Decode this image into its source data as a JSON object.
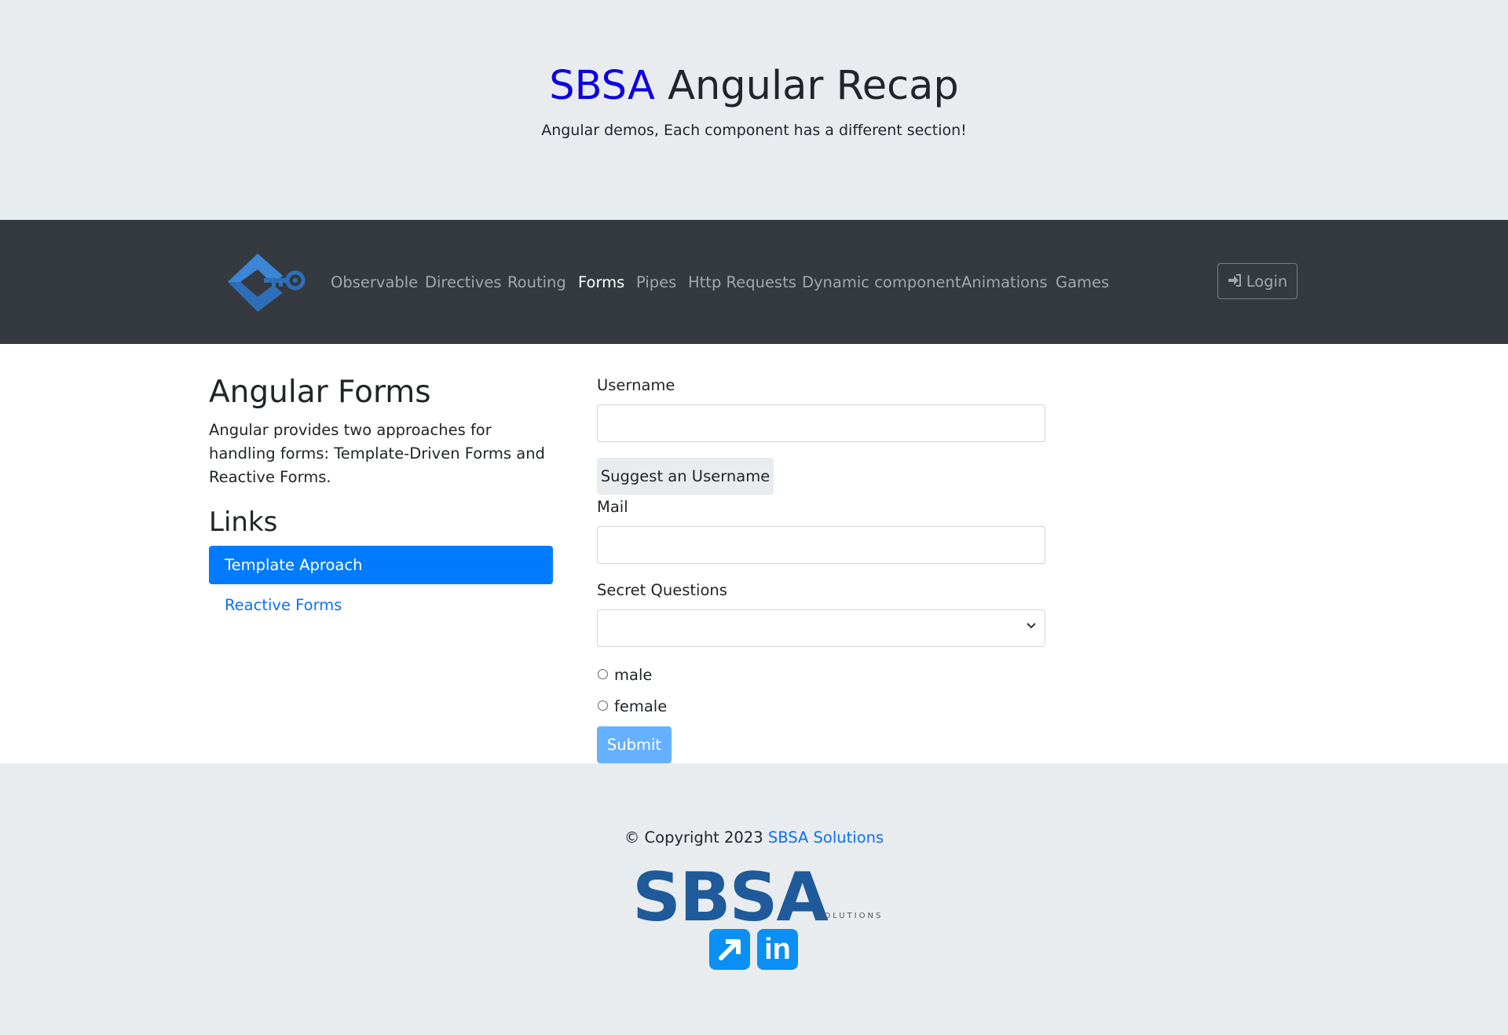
{
  "hero": {
    "brand": "SBSA",
    "title_rest": "Angular Recap",
    "subtitle": "Angular demos, Each component has a different section!"
  },
  "nav": {
    "items": [
      {
        "label": "Observable",
        "active": false
      },
      {
        "label": "Directives",
        "active": false
      },
      {
        "label": "Routing",
        "active": false
      },
      {
        "label": "Forms",
        "active": true
      },
      {
        "label": "Pipes",
        "active": false
      },
      {
        "label": "Http Requests",
        "active": false
      },
      {
        "label": "Dynamic component",
        "active": false
      },
      {
        "label": "Animations",
        "active": false
      },
      {
        "label": "Games",
        "active": false
      }
    ],
    "login_label": "Login",
    "login_icon": "sign-in-icon"
  },
  "sidebar": {
    "title": "Angular Forms",
    "description": "Angular provides two approaches for handling forms: Template-Driven Forms and Reactive Forms.",
    "links_title": "Links",
    "links": [
      {
        "label": "Template Aproach",
        "active": true
      },
      {
        "label": "Reactive Forms",
        "active": false
      }
    ]
  },
  "form": {
    "username_label": "Username",
    "username_value": "",
    "suggest_label": "Suggest an Username",
    "mail_label": "Mail",
    "mail_value": "",
    "secret_label": "Secret Questions",
    "secret_value": "",
    "gender_options": [
      "male",
      "female"
    ],
    "submit_label": "Submit"
  },
  "footer": {
    "copyright_prefix": "© Copyright 2023",
    "company_link": "SBSA Solutions",
    "logo_text": "SBSA",
    "logo_sub": "SOLUTIONS",
    "linkedin_text": "in"
  },
  "colors": {
    "brand_blue": "#0d00e0",
    "primary": "#007bff",
    "navbar": "#343a40",
    "jumbotron": "#e9ecef"
  }
}
